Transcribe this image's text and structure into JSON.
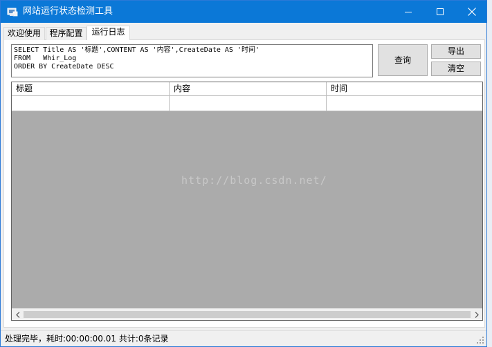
{
  "window": {
    "title": "网站运行状态检测工具",
    "title_bar_color": "#0b78d7"
  },
  "tabs": [
    {
      "label": "欢迎使用",
      "active": false
    },
    {
      "label": "程序配置",
      "active": false
    },
    {
      "label": "运行日志",
      "active": true
    }
  ],
  "query": {
    "sql": "SELECT Title AS '标题',CONTENT AS '内容',CreateDate AS '时间'\nFROM   Whir_Log\nORDER BY CreateDate DESC"
  },
  "buttons": {
    "query_label": "查询",
    "export_label": "导出",
    "clear_label": "清空"
  },
  "grid": {
    "columns": [
      "标题",
      "内容",
      "时间"
    ]
  },
  "watermark": "http://blog.csdn.net/",
  "status": {
    "text": "处理完毕，耗时:00:00:00.01 共计:0条记录"
  },
  "icons": [
    "app-icon",
    "minimize-icon",
    "maximize-icon",
    "close-icon",
    "scroll-left-icon",
    "scroll-right-icon",
    "resize-grip-icon"
  ]
}
